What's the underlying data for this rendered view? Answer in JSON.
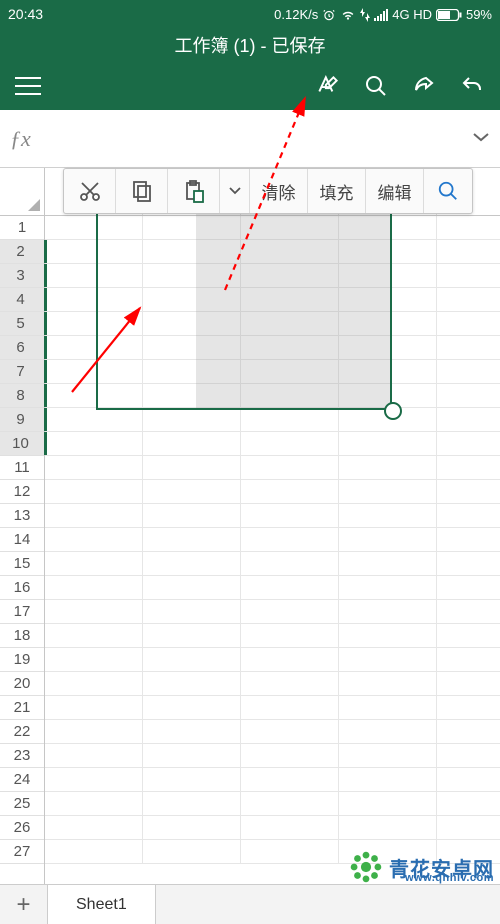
{
  "status": {
    "time": "20:43",
    "speed": "0.12K/s",
    "network": "4G HD",
    "battery_pct": "59%"
  },
  "title": "工作簿 (1) - 已保存",
  "context_toolbar": {
    "clear": "清除",
    "fill": "填充",
    "edit": "编辑"
  },
  "rows": [
    "1",
    "2",
    "3",
    "4",
    "5",
    "6",
    "7",
    "8",
    "9",
    "10",
    "11",
    "12",
    "13",
    "14",
    "15",
    "16",
    "17",
    "18",
    "19",
    "20",
    "21",
    "22",
    "23",
    "24",
    "25",
    "26",
    "27"
  ],
  "selected_rows": [
    2,
    3,
    4,
    5,
    6,
    7,
    8,
    9,
    10
  ],
  "sheet_tab": "Sheet1",
  "watermark": {
    "brand": "青花安卓网",
    "url": "www.qhhlv.com"
  },
  "colors": {
    "brand": "#1a6b47"
  }
}
